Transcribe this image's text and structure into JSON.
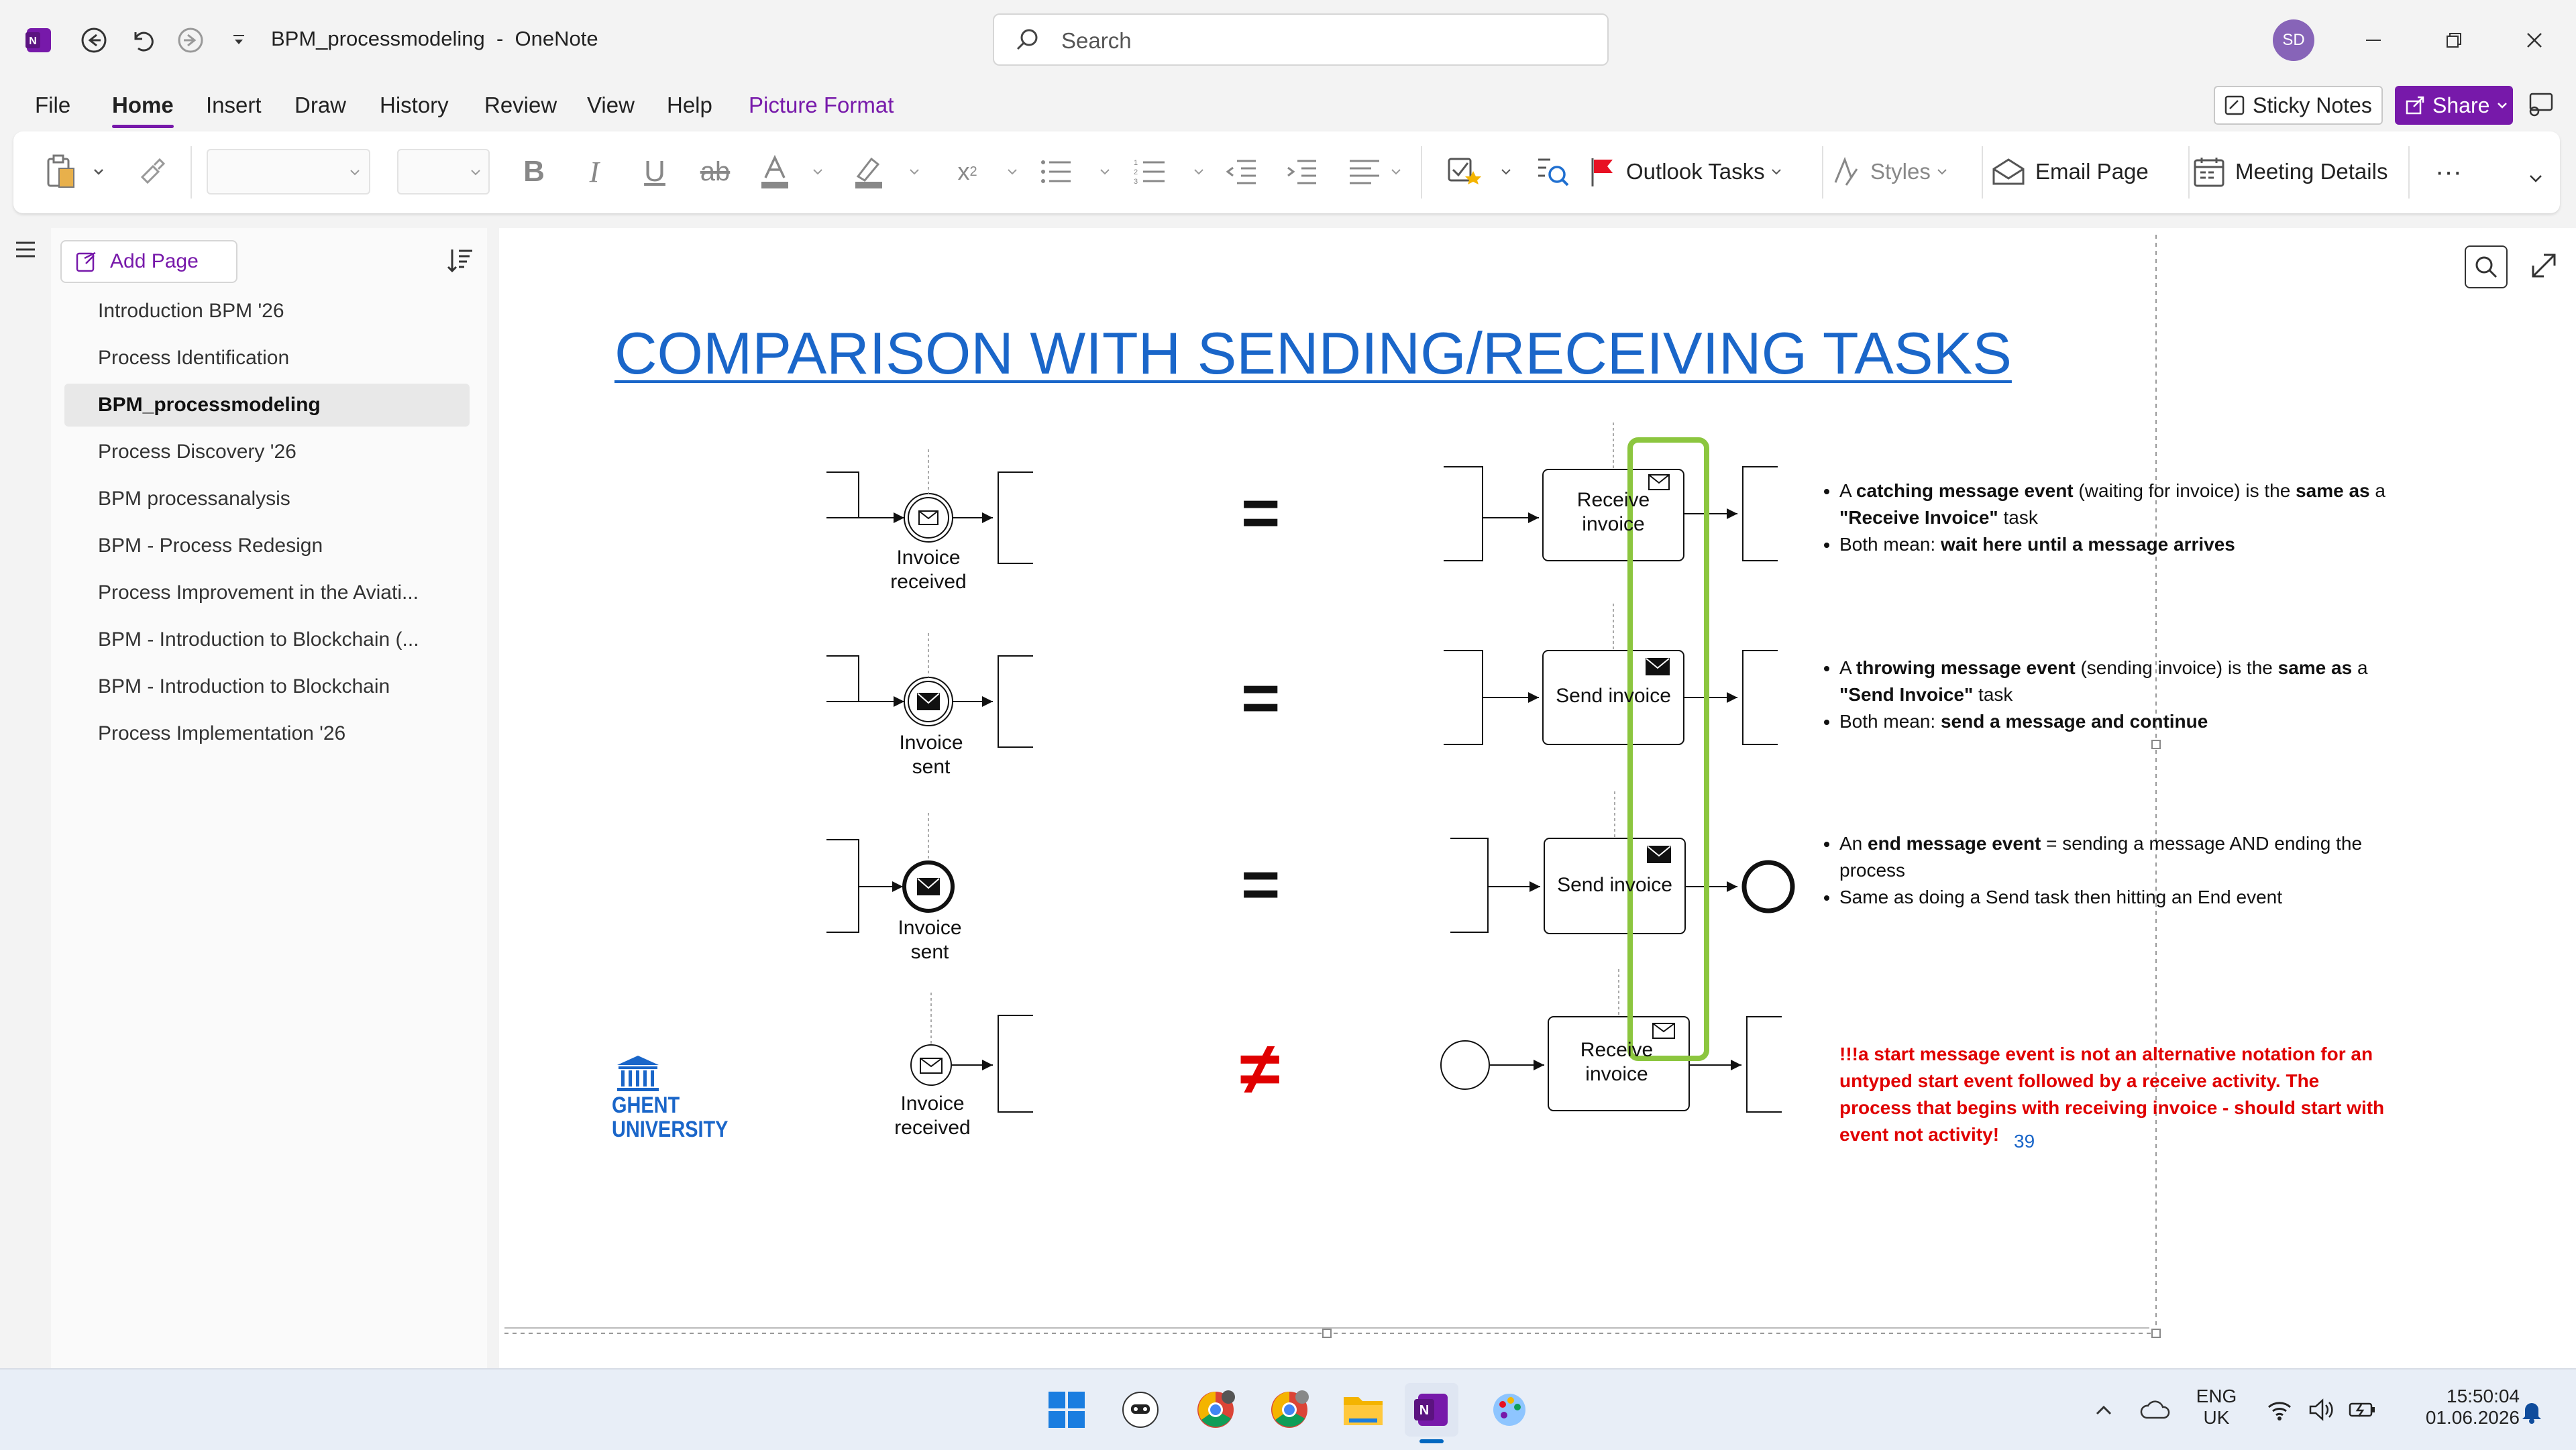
{
  "window": {
    "doc_title": "BPM_processmodeling  -  OneNote",
    "search_placeholder": "Search",
    "avatar_initials": "SD"
  },
  "menu": {
    "items": [
      "File",
      "Home",
      "Insert",
      "Draw",
      "History",
      "Review",
      "View",
      "Help",
      "Picture Format"
    ],
    "active": "Home",
    "picture_format_color": "#7719aa",
    "sticky_notes": "Sticky Notes",
    "share": "Share"
  },
  "ribbon": {
    "outlook_tasks": "Outlook Tasks",
    "styles": "Styles",
    "email_page": "Email Page",
    "meeting_details": "Meeting Details"
  },
  "sidebar": {
    "add_page": "Add Page",
    "pages": [
      "Introduction BPM '26",
      "Process Identification",
      "BPM_processmodeling",
      "Process Discovery '26",
      "BPM processanalysis",
      "BPM - Process Redesign",
      "Process Improvement in the Aviati...",
      "BPM - Introduction to Blockchain (...",
      "BPM - Introduction to Blockchain",
      "Process Implementation '26"
    ],
    "selected_index": 2
  },
  "slide": {
    "title": "COMPARISON WITH SENDING/RECEIVING TASKS",
    "rows": [
      {
        "event_label_1": "Invoice",
        "event_label_2": "received",
        "relation": "=",
        "task_label_1": "Receive",
        "task_label_2": "invoice",
        "bullets": [
          [
            "A ",
            "catching message event",
            " (waiting for invoice) is the ",
            "same as",
            " a ",
            "\"Receive Invoice\"",
            " task"
          ],
          [
            "Both mean: ",
            "wait here until a message arrives",
            "",
            "",
            "",
            "",
            ""
          ]
        ]
      },
      {
        "event_label_1": "Invoice",
        "event_label_2": "sent",
        "relation": "=",
        "task_label_1": "Send invoice",
        "task_label_2": "",
        "bullets": [
          [
            "A ",
            "throwing message event",
            " (sending invoice) is the ",
            "same as",
            " a ",
            "\"Send Invoice\"",
            " task"
          ],
          [
            "Both mean: ",
            "send a message and continue",
            "",
            "",
            "",
            "",
            ""
          ]
        ]
      },
      {
        "event_label_1": "Invoice",
        "event_label_2": "sent",
        "relation": "=",
        "task_label_1": "Send invoice",
        "task_label_2": "",
        "bullets_plain": [
          [
            "An ",
            "end message event",
            " = sending a message AND ending the process"
          ],
          [
            "Same as doing a Send task then hitting an End event",
            "",
            ""
          ]
        ]
      },
      {
        "event_label_1": "Invoice",
        "event_label_2": "received",
        "relation": "≠",
        "task_label_1": "Receive",
        "task_label_2": "invoice"
      }
    ],
    "red_note": "!!!a start message event is not an alternative notation for an untyped start event followed by a receive activity. The process that begins with receiving invoice - should start with event not activity!",
    "page_number": "39",
    "logo_line1": "GHENT",
    "logo_line2": "UNIVERSITY",
    "highlight_color": "#8cc63f",
    "title_color": "#1a66c9",
    "note_color": "#e00000"
  },
  "taskbar": {
    "lang_1": "ENG",
    "lang_2": "UK",
    "time": "15:50:04",
    "date": "01.06.2026"
  }
}
